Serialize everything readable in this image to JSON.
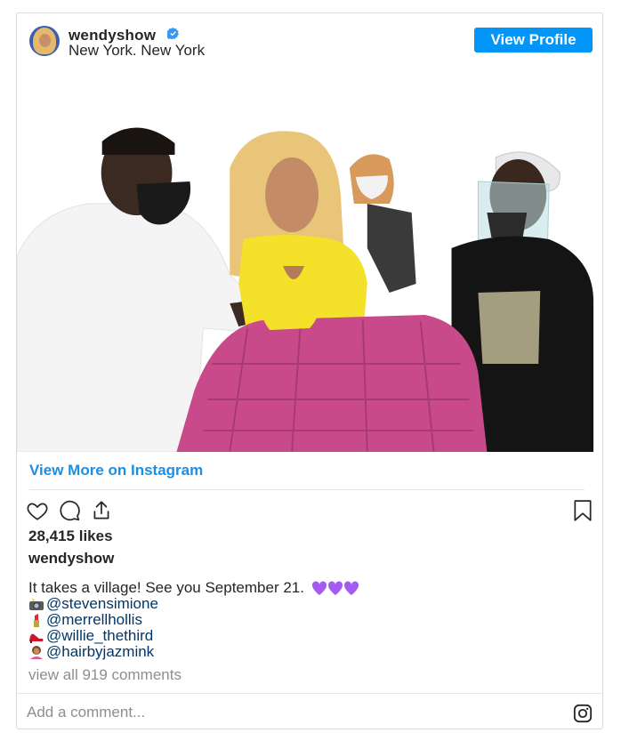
{
  "post": {
    "username": "wendyshow",
    "location": "New York. New York",
    "view_profile_label": "View Profile",
    "view_more_label": "View More on Instagram",
    "likes": "28,415 likes",
    "caption_owner": "wendyshow",
    "caption_text": "It takes a village! See you September 21.",
    "caption_emoji": "purple-hearts",
    "credits": [
      {
        "icon": "camera-flash-icon",
        "handle": "@stevensimione"
      },
      {
        "icon": "lipstick-icon",
        "handle": "@merrellhollis"
      },
      {
        "icon": "high-heel-icon",
        "handle": "@willie_thethird"
      },
      {
        "icon": "haircut-icon",
        "handle": "@hairbyjazmink"
      }
    ],
    "comments_link": "view all 919 comments",
    "add_comment_placeholder": "Add a comment..."
  },
  "colors": {
    "accent": "#0095f6",
    "link": "#1a8fe6",
    "muted": "#8e8e8e",
    "border": "#dbdbdb"
  }
}
